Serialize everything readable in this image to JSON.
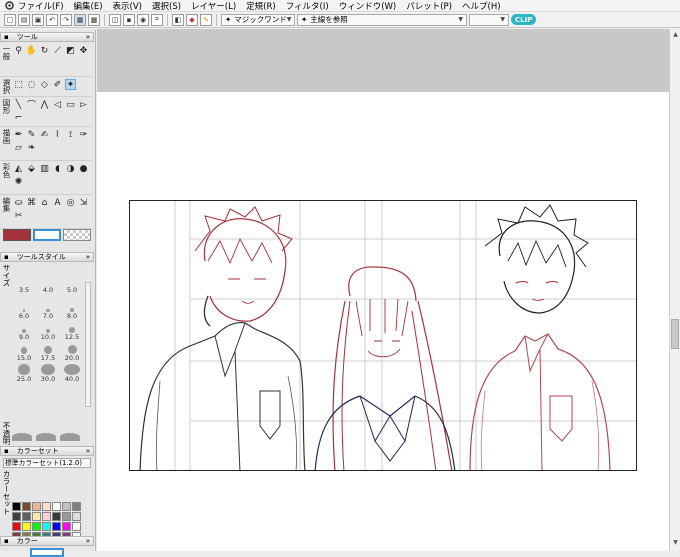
{
  "menubar": {
    "items": [
      "ファイル(F)",
      "編集(E)",
      "表示(V)",
      "選択(S)",
      "レイヤー(L)",
      "定規(R)",
      "フィルタ(I)",
      "ウィンドウ(W)",
      "パレット(P)",
      "ヘルプ(H)"
    ]
  },
  "toolbar": {
    "tool_option": "マジックワンド",
    "reference": "主線を参照",
    "badge": "CLIP"
  },
  "tool_panel": {
    "title": "ツール",
    "groups": [
      {
        "label": "一般"
      },
      {
        "label": "選択"
      },
      {
        "label": "図形"
      },
      {
        "label": "描画"
      },
      {
        "label": "彩色"
      },
      {
        "label": "編集"
      }
    ]
  },
  "tool_style_panel": {
    "title": "ツールスタイル",
    "size_label": "サイズ",
    "opacity_label": "不透明",
    "sizes": [
      "3.5",
      "4.0",
      "5.0",
      "6.0",
      "7.0",
      "8.0",
      "9.0",
      "10.0",
      "12.5",
      "15.0",
      "17.5",
      "20.0",
      "25.0",
      "30.0",
      "40.0"
    ]
  },
  "color_set_panel": {
    "title": "カラーセット",
    "set_name": "標準カラーセット(1.2.0)",
    "side_label": "カラーセット",
    "swatches": [
      "#000000",
      "#7a4a2a",
      "#f2b48c",
      "#ffe0c8",
      "#ffffff",
      "#c0c0c0",
      "#808080",
      "#404040",
      "#606060",
      "#ffe7a8",
      "#ffd0d0",
      "#3a3a3a",
      "#999999",
      "#dcdcdc",
      "#ff0000",
      "#ffff00",
      "#00ff00",
      "#00ffff",
      "#0000ff",
      "#ff00ff",
      "#ffffff",
      "#804040",
      "#808040",
      "#408040",
      "#408080",
      "#404080",
      "#804080",
      "#ffffff"
    ]
  },
  "color_panel": {
    "title": "カラー"
  },
  "colors": {
    "main": "#a3333a",
    "sub": "#ffffff",
    "accent": "#3b8fd6"
  }
}
